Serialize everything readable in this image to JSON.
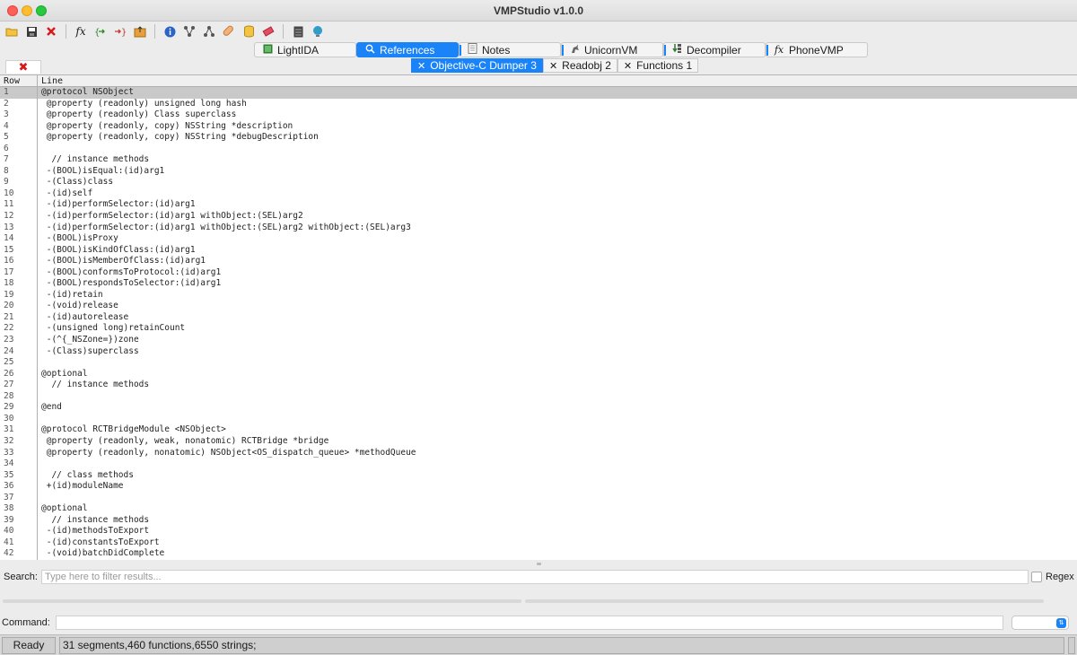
{
  "window": {
    "title": "VMPStudio v1.0.0"
  },
  "toolbar": {
    "icons": [
      "open-folder-icon",
      "save-icon",
      "close-icon",
      "function-icon",
      "jump-to-icon",
      "jump-from-icon",
      "export-icon",
      "info-icon",
      "graph-icon",
      "graph2-icon",
      "patch-icon",
      "database-icon",
      "eraser-icon",
      "terminal-icon",
      "globe-icon"
    ],
    "fx_label": "fx"
  },
  "main_tabs": [
    {
      "label": "LightIDA",
      "icon": "lightida-icon"
    },
    {
      "label": "References",
      "icon": "search-icon",
      "active": true
    },
    {
      "label": "Notes",
      "icon": "notes-icon"
    },
    {
      "label": "UnicornVM",
      "icon": "unicorn-icon"
    },
    {
      "label": "Decompiler",
      "icon": "decompiler-icon"
    },
    {
      "label": "PhoneVMP",
      "icon": "fx-icon"
    }
  ],
  "sub_tabs": [
    {
      "label": "Objective-C Dumper 3",
      "active": true
    },
    {
      "label": "Readobj 2"
    },
    {
      "label": "Functions 1"
    }
  ],
  "table": {
    "headers": {
      "row": "Row",
      "line": "Line"
    },
    "selected_row": 1,
    "rows": [
      {
        "n": "1",
        "text": "@protocol NSObject"
      },
      {
        "n": "2",
        "text": " @property (readonly) unsigned long hash"
      },
      {
        "n": "3",
        "text": " @property (readonly) Class superclass"
      },
      {
        "n": "4",
        "text": " @property (readonly, copy) NSString *description"
      },
      {
        "n": "5",
        "text": " @property (readonly, copy) NSString *debugDescription"
      },
      {
        "n": "6",
        "text": ""
      },
      {
        "n": "7",
        "text": "  // instance methods"
      },
      {
        "n": "8",
        "text": " -(BOOL)isEqual:(id)arg1"
      },
      {
        "n": "9",
        "text": " -(Class)class"
      },
      {
        "n": "10",
        "text": " -(id)self"
      },
      {
        "n": "11",
        "text": " -(id)performSelector:(id)arg1"
      },
      {
        "n": "12",
        "text": " -(id)performSelector:(id)arg1 withObject:(SEL)arg2"
      },
      {
        "n": "13",
        "text": " -(id)performSelector:(id)arg1 withObject:(SEL)arg2 withObject:(SEL)arg3"
      },
      {
        "n": "14",
        "text": " -(BOOL)isProxy"
      },
      {
        "n": "15",
        "text": " -(BOOL)isKindOfClass:(id)arg1"
      },
      {
        "n": "16",
        "text": " -(BOOL)isMemberOfClass:(id)arg1"
      },
      {
        "n": "17",
        "text": " -(BOOL)conformsToProtocol:(id)arg1"
      },
      {
        "n": "18",
        "text": " -(BOOL)respondsToSelector:(id)arg1"
      },
      {
        "n": "19",
        "text": " -(id)retain"
      },
      {
        "n": "20",
        "text": " -(void)release"
      },
      {
        "n": "21",
        "text": " -(id)autorelease"
      },
      {
        "n": "22",
        "text": " -(unsigned long)retainCount"
      },
      {
        "n": "23",
        "text": " -(^{_NSZone=})zone"
      },
      {
        "n": "24",
        "text": " -(Class)superclass"
      },
      {
        "n": "25",
        "text": ""
      },
      {
        "n": "26",
        "text": "@optional"
      },
      {
        "n": "27",
        "text": "  // instance methods"
      },
      {
        "n": "28",
        "text": ""
      },
      {
        "n": "29",
        "text": "@end"
      },
      {
        "n": "30",
        "text": ""
      },
      {
        "n": "31",
        "text": "@protocol RCTBridgeModule <NSObject>"
      },
      {
        "n": "32",
        "text": " @property (readonly, weak, nonatomic) RCTBridge *bridge"
      },
      {
        "n": "33",
        "text": " @property (readonly, nonatomic) NSObject<OS_dispatch_queue> *methodQueue"
      },
      {
        "n": "34",
        "text": ""
      },
      {
        "n": "35",
        "text": "  // class methods"
      },
      {
        "n": "36",
        "text": " +(id)moduleName"
      },
      {
        "n": "37",
        "text": ""
      },
      {
        "n": "38",
        "text": "@optional"
      },
      {
        "n": "39",
        "text": "  // instance methods"
      },
      {
        "n": "40",
        "text": " -(id)methodsToExport"
      },
      {
        "n": "41",
        "text": " -(id)constantsToExport"
      },
      {
        "n": "42",
        "text": " -(void)batchDidComplete"
      }
    ]
  },
  "search": {
    "label": "Search:",
    "placeholder": "Type here to filter results...",
    "regex_label": "Regex"
  },
  "command": {
    "label": "Command:"
  },
  "status": {
    "state": "Ready",
    "info": "31 segments,460 functions,6550 strings;"
  },
  "colors": {
    "accent": "#1a83f7",
    "selected_row": "#c9c9c9"
  }
}
